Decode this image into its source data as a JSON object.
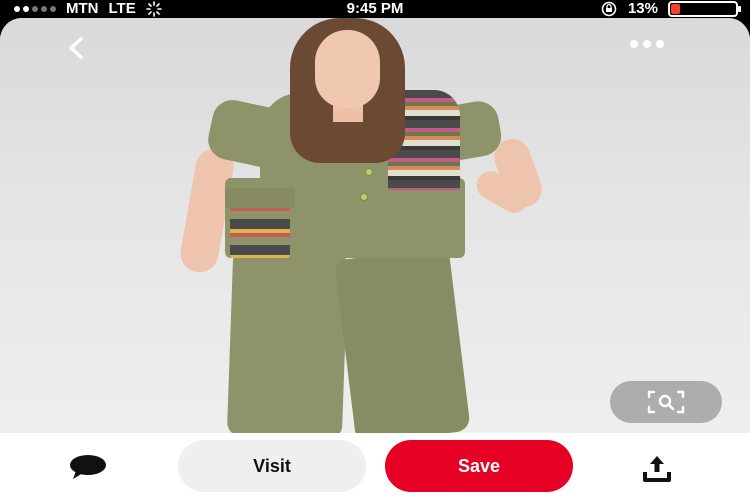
{
  "status_bar": {
    "carrier": "MTN",
    "network": "LTE",
    "time": "9:45 PM",
    "battery_percent": "13%",
    "battery_level": 0.13,
    "signal_bars_filled": 2,
    "signal_bars_total": 5,
    "icons": [
      "signal-dots-icon",
      "loading-spinner-icon",
      "orientation-lock-icon",
      "battery-icon"
    ]
  },
  "header": {
    "back_icon": "chevron-left-icon",
    "more_icon": "more-dots-icon"
  },
  "image": {
    "subject": "woman in olive green tunic and trouser suit"
  },
  "overlay": {
    "visual_search_icon": "visual-search-icon"
  },
  "actions": {
    "comment_icon": "comment-bubble-icon",
    "visit_label": "Visit",
    "save_label": "Save",
    "share_icon": "share-upload-icon",
    "save_color": "#e60023",
    "visit_color": "#efefef"
  }
}
